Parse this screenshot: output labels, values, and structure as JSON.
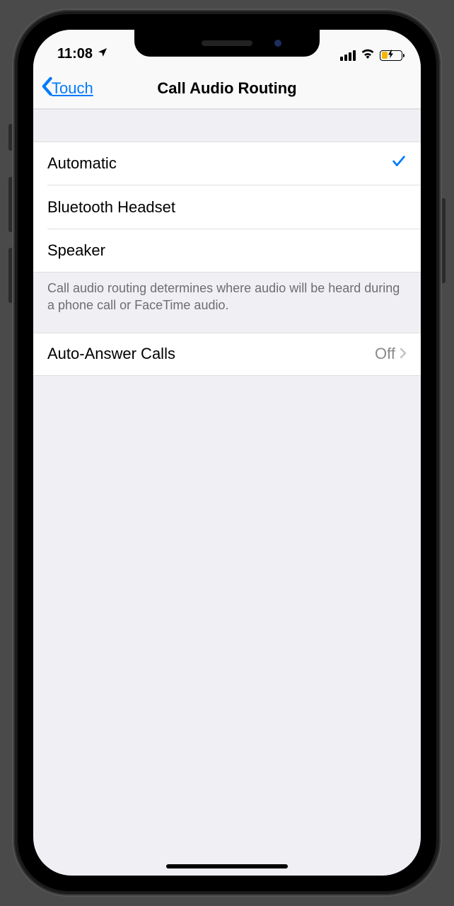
{
  "status": {
    "time": "11:08",
    "location_icon": "location-arrow"
  },
  "nav": {
    "back_label": "Touch",
    "title": "Call Audio Routing"
  },
  "routing_options": [
    {
      "label": "Automatic",
      "selected": true
    },
    {
      "label": "Bluetooth Headset",
      "selected": false
    },
    {
      "label": "Speaker",
      "selected": false
    }
  ],
  "routing_footer": "Call audio routing determines where audio will be heard during a phone call or FaceTime audio.",
  "auto_answer": {
    "label": "Auto-Answer Calls",
    "value": "Off"
  }
}
